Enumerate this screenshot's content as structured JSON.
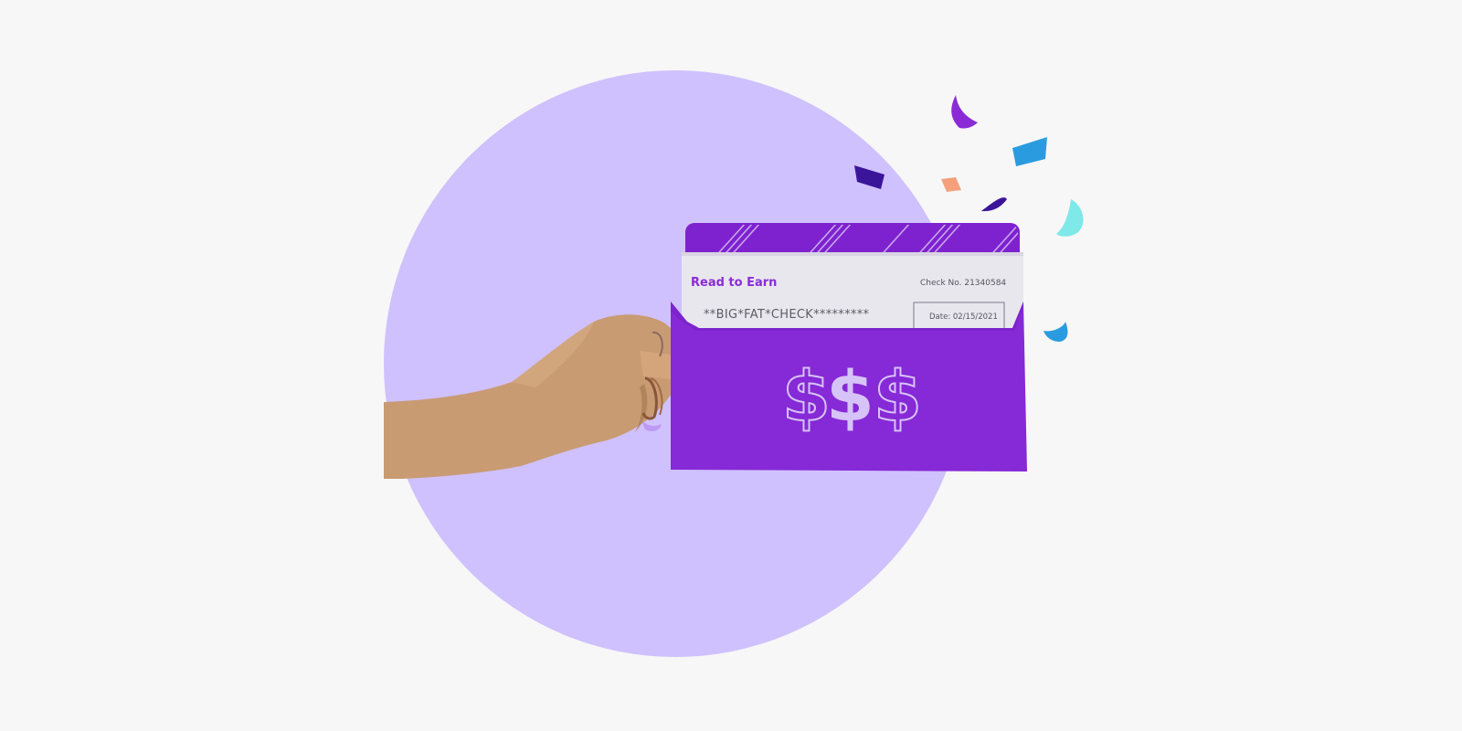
{
  "check": {
    "title": "Read to Earn",
    "number": "Check No. 21340584",
    "payee": "**BIG*FAT*CHECK*********",
    "date": "Date: 02/15/2021"
  },
  "envelope": {
    "symbols": "$$$"
  },
  "colors": {
    "background": "#f7f7f7",
    "circle": "#cfc1fd",
    "envelope": "#8629d6",
    "check": "#e9e7ee",
    "skin": "#c99b72",
    "nail": "#b98ef0"
  },
  "icons": [
    "hand",
    "envelope",
    "check",
    "dollar-sign-icon",
    "confetti"
  ]
}
